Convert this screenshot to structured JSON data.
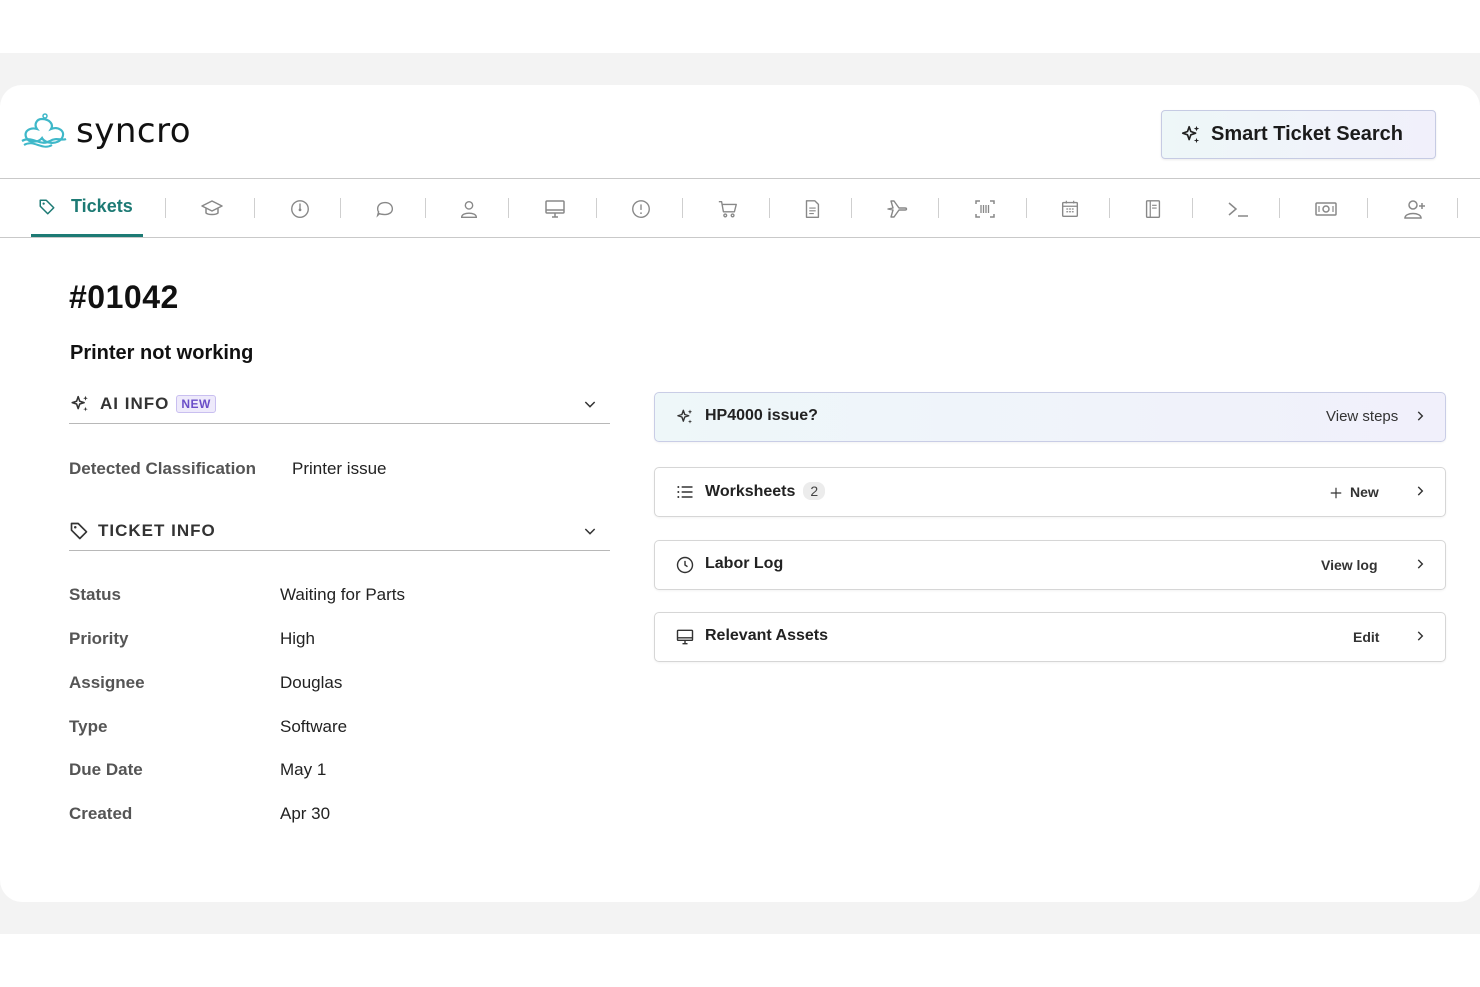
{
  "app": {
    "name": "syncro"
  },
  "header": {
    "smart_search_label": "Smart Ticket Search"
  },
  "nav": {
    "active_tab": "Tickets",
    "icons": [
      "graduation-cap-icon",
      "gauge-icon",
      "chat-icon",
      "user-icon",
      "monitor-icon",
      "alert-icon",
      "cart-icon",
      "invoice-icon",
      "plane-icon",
      "barcode-icon",
      "calendar-icon",
      "book-icon",
      "terminal-icon",
      "cash-icon",
      "add-user-icon"
    ]
  },
  "ticket": {
    "number": "#01042",
    "title": "Printer not working"
  },
  "ai_info": {
    "label": "AI INFO",
    "badge": "NEW",
    "detected_classification_label": "Detected Classification",
    "detected_classification_value": "Printer issue"
  },
  "ticket_info": {
    "label": "TICKET INFO",
    "fields": [
      {
        "label": "Status",
        "value": "Waiting for Parts"
      },
      {
        "label": "Priority",
        "value": "High"
      },
      {
        "label": "Assignee",
        "value": "Douglas"
      },
      {
        "label": "Type",
        "value": "Software"
      },
      {
        "label": "Due Date",
        "value": "May 1"
      },
      {
        "label": "Created",
        "value": "Apr 30"
      }
    ]
  },
  "panels": {
    "ai_suggestion": {
      "title": "HP4000 issue?",
      "action": "View steps"
    },
    "worksheets": {
      "title": "Worksheets",
      "count": "2",
      "action": "New"
    },
    "labor_log": {
      "title": "Labor Log",
      "action": "View log"
    },
    "relevant_assets": {
      "title": "Relevant Assets",
      "action": "Edit"
    }
  },
  "colors": {
    "accent": "#1d7a74",
    "badge": "#6b4fc8"
  }
}
